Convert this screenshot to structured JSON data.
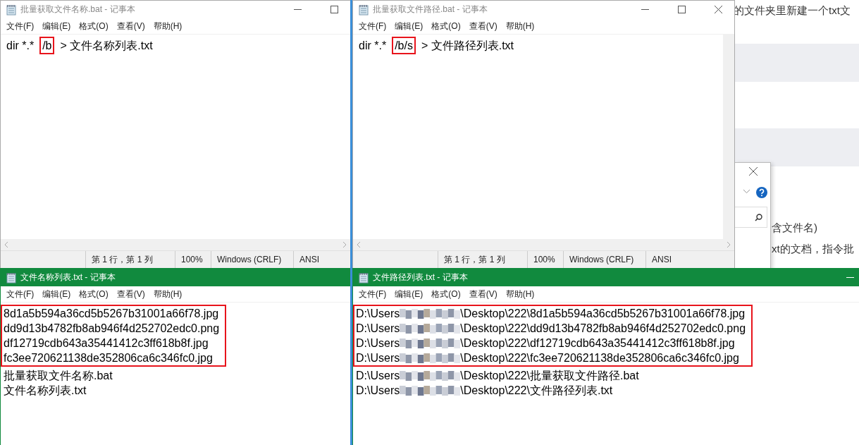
{
  "background_page": {
    "lines": [
      {
        "text": "的文件夹里新建一个txt文",
        "kind": "top"
      },
      {
        "text": "含文件名)",
        "kind": "mid"
      },
      {
        "text": "xt的文档，指令批",
        "kind": "low"
      }
    ]
  },
  "windows": [
    {
      "title": "批量获取文件名称.bat - 记事本",
      "active": false,
      "menu": [
        "文件(F)",
        "编辑(E)",
        "格式(O)",
        "查看(V)",
        "帮助(H)"
      ],
      "lines": [
        {
          "segments": [
            {
              "text": "dir *.*",
              "highlighted": false
            },
            {
              "text": "/b",
              "highlighted": true
            },
            {
              "text": "> 文件名称列表.txt",
              "highlighted": false
            }
          ]
        }
      ],
      "status_bar": [
        "第 1 行，第 1 列",
        "100%",
        "Windows (CRLF)",
        "ANSI"
      ]
    },
    {
      "title": "批量获取文件路径.bat - 记事本",
      "active": false,
      "menu": [
        "文件(F)",
        "编辑(E)",
        "格式(O)",
        "查看(V)",
        "帮助(H)"
      ],
      "lines": [
        {
          "segments": [
            {
              "text": "dir *.*",
              "highlighted": false
            },
            {
              "text": "/b/s",
              "highlighted": true
            },
            {
              "text": "> 文件路径列表.txt",
              "highlighted": false
            }
          ]
        }
      ],
      "status_bar": [
        "第 1 行，第 1 列",
        "100%",
        "Windows (CRLF)",
        "ANSI"
      ]
    },
    {
      "title": "文件名称列表.txt - 记事本",
      "active": true,
      "menu": [
        "文件(F)",
        "编辑(E)",
        "格式(O)",
        "查看(V)",
        "帮助(H)"
      ],
      "highlight_box": [
        {
          "text": "8d1a5b594a36cd5b5267b31001a66f78.jpg"
        },
        {
          "text": "dd9d13b4782fb8ab946f4d252702edc0.png"
        },
        {
          "text": "df12719cdb643a35441412c3ff618b8f.jpg"
        },
        {
          "text": "fc3ee720621138de352806ca6c346fc0.jpg"
        }
      ],
      "lines": [
        {
          "text": "批量获取文件名称.bat"
        },
        {
          "text": "文件名称列表.txt"
        }
      ]
    },
    {
      "title": "文件路径列表.txt - 记事本",
      "active": true,
      "menu": [
        "文件(F)",
        "编辑(E)",
        "格式(O)",
        "查看(V)",
        "帮助(H)"
      ],
      "highlight_box": [
        {
          "prefix": "D:\\Users",
          "text": "\\Desktop\\222\\8d1a5b594a36cd5b5267b31001a66f78.jpg"
        },
        {
          "prefix": "D:\\Users",
          "text": "\\Desktop\\222\\dd9d13b4782fb8ab946f4d252702edc0.png"
        },
        {
          "prefix": "D:\\Users",
          "text": "\\Desktop\\222\\df12719cdb643a35441412c3ff618b8f.jpg"
        },
        {
          "prefix": "D:\\Users",
          "text": "\\Desktop\\222\\fc3ee720621138de352806ca6c346fc0.jpg"
        }
      ],
      "lines": [
        {
          "prefix": "D:\\Users",
          "text": "\\Desktop\\222\\批量获取文件路径.bat"
        },
        {
          "prefix": "D:\\Users",
          "text": "\\Desktop\\222\\文件路径列表.txt"
        }
      ]
    }
  ]
}
